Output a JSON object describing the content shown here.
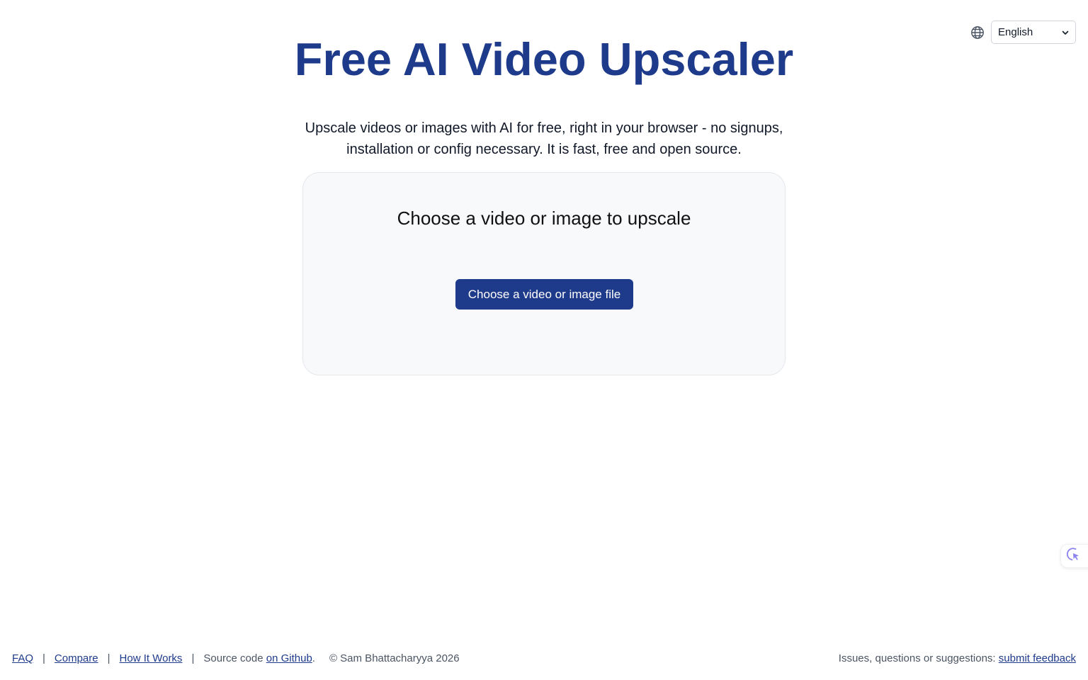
{
  "header": {
    "language_selected": "English",
    "globe_icon": "globe-icon",
    "chevron_icon": "chevron-down-icon"
  },
  "main": {
    "title": "Free AI Video Upscaler",
    "subtitle": "Upscale videos or images with AI for free, right in your browser - no signups, installation or config necessary. It is fast, free and open source.",
    "upload_heading": "Choose a video or image to upscale",
    "choose_button_label": "Choose a video or image file"
  },
  "floating_widget": {
    "icon": "cursor-click-icon"
  },
  "footer": {
    "links": {
      "faq": "FAQ",
      "compare": "Compare",
      "how_it_works": "How It Works"
    },
    "separator": "|",
    "source_prefix": "Source code ",
    "source_link": "on Github",
    "source_suffix": ".",
    "copyright": "© Sam Bhattacharyya 2026",
    "feedback_prefix": "Issues, questions or suggestions: ",
    "feedback_link": "submit feedback"
  },
  "colors": {
    "brand": "#1e3a8a",
    "panel_bg": "#f8f9fb",
    "text": "#111827",
    "muted": "#4b5563"
  }
}
